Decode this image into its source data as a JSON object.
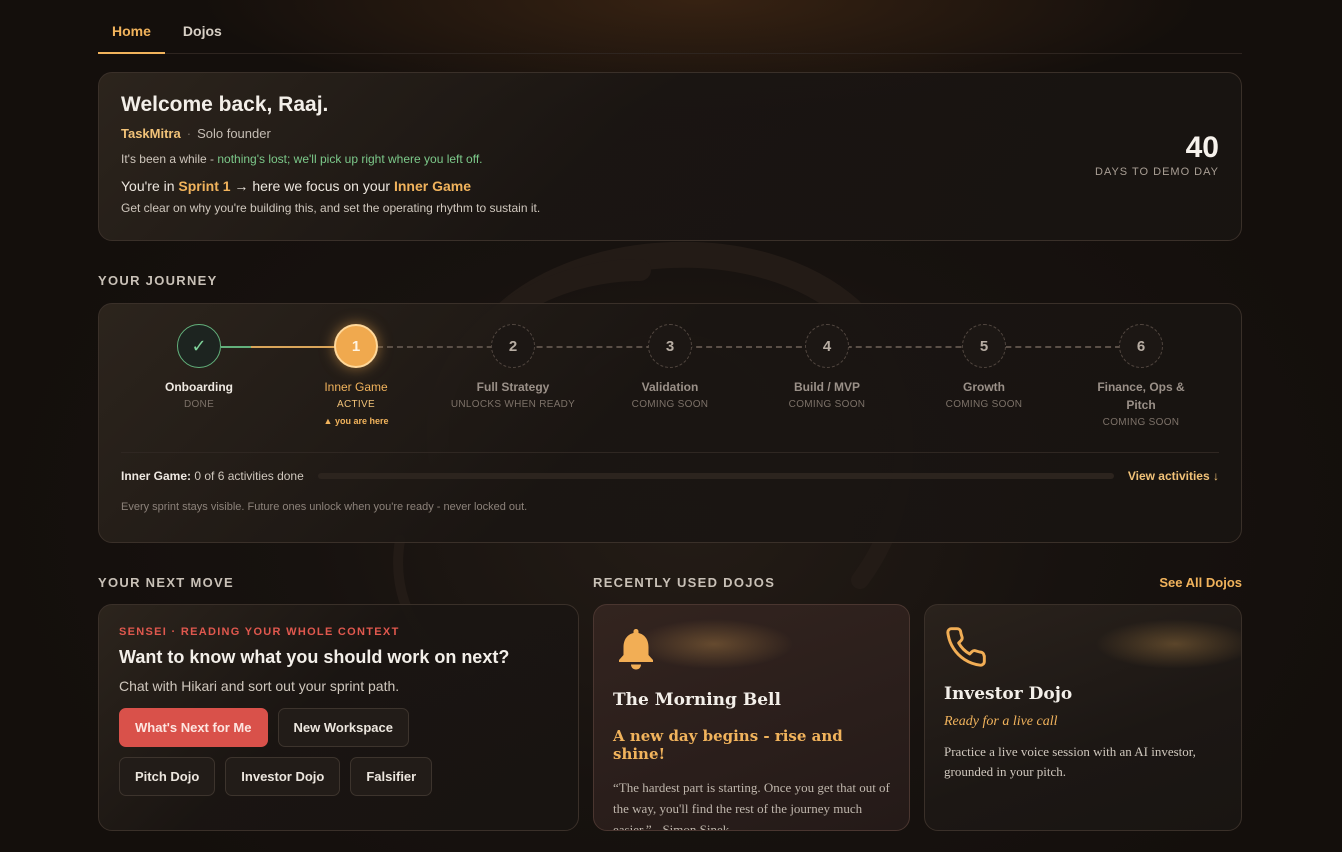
{
  "tabs": [
    {
      "label": "Home",
      "active": true
    },
    {
      "label": "Dojos",
      "active": false
    }
  ],
  "welcome": {
    "title": "Welcome back, Raaj.",
    "company": "TaskMitra",
    "role": "Solo founder",
    "while_prefix": "It's been a while - ",
    "while_highlight": "nothing's lost; we'll pick up right where you left off.",
    "sprint_prefix": "You're in ",
    "sprint_name": "Sprint 1",
    "sprint_middle": " → here we focus on your ",
    "sprint_focus": "Inner Game",
    "sprint_sub": "Get clear on why you're building this, and set the operating rhythm to sustain it.",
    "days_number": "40",
    "days_label": "DAYS TO DEMO DAY"
  },
  "journey": {
    "section_title": "YOUR JOURNEY",
    "steps": [
      {
        "circle": "✓",
        "name": "Onboarding",
        "status": "DONE",
        "state": "done"
      },
      {
        "circle": "1",
        "name": "Inner Game",
        "status": "ACTIVE",
        "state": "active",
        "marker": "▲ you are here"
      },
      {
        "circle": "2",
        "name": "Full Strategy",
        "status": "UNLOCKS WHEN READY",
        "state": "locked"
      },
      {
        "circle": "3",
        "name": "Validation",
        "status": "COMING SOON",
        "state": "locked"
      },
      {
        "circle": "4",
        "name": "Build / MVP",
        "status": "COMING SOON",
        "state": "locked"
      },
      {
        "circle": "5",
        "name": "Growth",
        "status": "COMING SOON",
        "state": "locked"
      },
      {
        "circle": "6",
        "name": "Finance, Ops & Pitch",
        "status": "COMING SOON",
        "state": "locked"
      }
    ],
    "progress_sprint": "Inner Game:",
    "progress_text": " 0 of 6 activities done",
    "progress_fraction": 0,
    "view_activities": "View activities ↓",
    "footnote": "Every sprint stays visible. Future ones unlock when you're ready - never locked out."
  },
  "next_move": {
    "section_title": "YOUR NEXT MOVE",
    "eyebrow": "SENSEI · READING YOUR WHOLE CONTEXT",
    "title": "Want to know what you should work on next?",
    "subtitle": "Chat with Hikari and sort out your sprint path.",
    "buttons": [
      "What's Next for Me",
      "New Workspace",
      "Pitch Dojo",
      "Investor Dojo",
      "Falsifier"
    ]
  },
  "dojos": {
    "section_title": "RECENTLY USED DOJOS",
    "see_all": "See All Dojos",
    "morning_bell": {
      "icon": "bell-icon",
      "title": "The Morning Bell",
      "tagline": "A new day begins - rise and shine!",
      "quote": "“The hardest part is starting. Once you get that out of the way, you'll find the rest of the journey much easier.” - Simon Sinek"
    },
    "investor": {
      "icon": "phone-icon",
      "title": "Investor Dojo",
      "tagline": "Ready for a live call",
      "description": "Practice a live voice session with an AI investor, grounded in your pitch."
    }
  },
  "colors": {
    "accent": "#f1b35c",
    "done": "#62b07b",
    "primary_button": "#d9514a"
  }
}
